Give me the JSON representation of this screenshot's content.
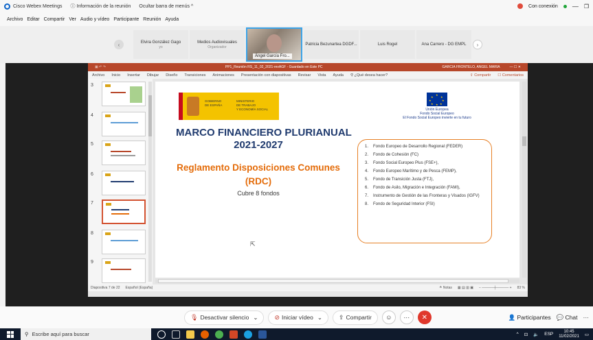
{
  "webex": {
    "app_title": "Cisco Webex Meetings",
    "info": "Información de la reunión",
    "hide_menu": "Ocultar barra de menús ^",
    "status": "Con conexión",
    "menu": [
      "Archivo",
      "Editar",
      "Compartir",
      "Ver",
      "Audio y vídeo",
      "Participante",
      "Reunión",
      "Ayuda"
    ]
  },
  "participants": [
    {
      "name": "Elvira González Gago",
      "sub": "yo"
    },
    {
      "name": "Medios Audiovisuales",
      "sub": "Organizador"
    },
    {
      "name": "Ángel García Fro...",
      "video": true
    },
    {
      "name": "Patricia Bezunartea DGDF..."
    },
    {
      "name": "Luis Rogel"
    },
    {
      "name": "Ana Carrero - DG EMPL"
    }
  ],
  "powerpoint": {
    "title": "PP1_Reunión RS_11_02_2021-revAGF  -  Guardado en Este PC",
    "user": "GARCIA FRONTELO, ANGEL MARIA",
    "ribbon": [
      "Archivo",
      "Inicio",
      "Insertar",
      "Dibujar",
      "Diseño",
      "Transiciones",
      "Animaciones",
      "Presentación con diapositivas",
      "Revisar",
      "Vista",
      "Ayuda",
      "¿Qué desea hacer?"
    ],
    "share": "Compartir",
    "comments": "Comentarios",
    "thumb_numbers": [
      "3",
      "4",
      "5",
      "6",
      "7",
      "8",
      "9"
    ],
    "status_left": "Diapositiva 7 de 22",
    "status_lang": "Español (España)",
    "notes": "Notas",
    "zoom": "83 %"
  },
  "slide": {
    "gov1": "GOBIERNO\nDE ESPAÑA",
    "gov2": "MINISTERIO\nDE TRABAJO\nY ECONOMÍA SOCIAL",
    "eu_text": "Unión Europea\nFondo Social Europeo\nEl Fondo Social Europeo invierte en tu futuro",
    "heading1": "MARCO FINANCIERO PLURIANUAL\n2021-2027",
    "heading2": "Reglamento Disposiciones Comunes\n(RDC)",
    "heading3": "Cubre 8 fondos",
    "funds": [
      "Fondo Europeo de Desarrollo Regional (FEDER)",
      "Fondo de Cohesión (FC)",
      "Fondo Social Europeo Plus (FSE+),",
      "Fondo Europeo Marítimo y de Pesca (FEMP),",
      "Fondo de Transición Justa (FTJ),",
      "Fondo de Asilo, Migración e Integración (FAMI),",
      "Instrumento de Gestión de las Fronteras y Visados (IGFV)",
      "Fondo de Seguridad Interior (FSI)"
    ]
  },
  "controls": {
    "mute": "Desactivar silencio",
    "video": "Iniciar vídeo",
    "share": "Compartir",
    "participants": "Participantes",
    "chat": "Chat"
  },
  "taskbar": {
    "search": "Escribe aquí para buscar",
    "lang": "ESP",
    "time": "10:45",
    "date": "11/02/2021"
  }
}
